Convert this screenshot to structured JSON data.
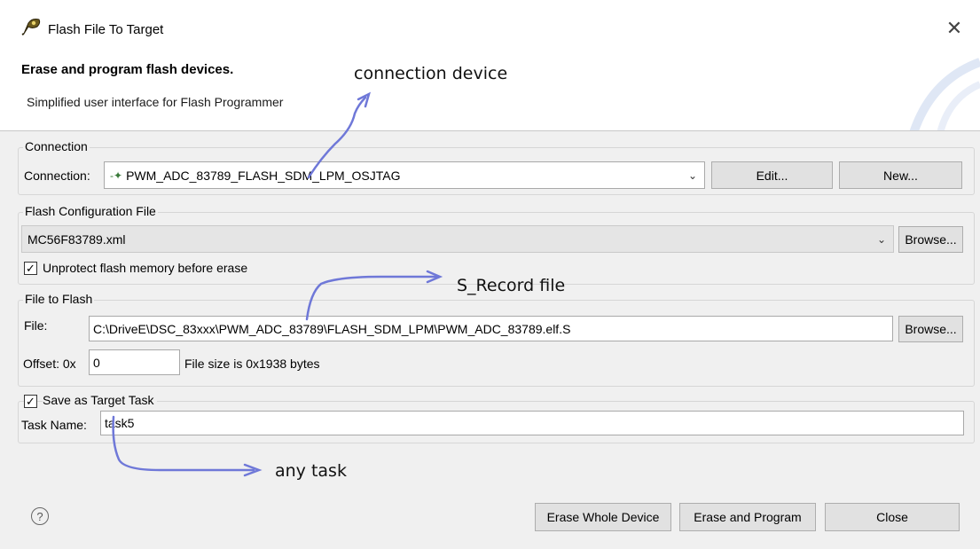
{
  "window": {
    "title": "Flash File To Target",
    "close_glyph": "✕"
  },
  "banner": {
    "title": "Erase and program flash devices.",
    "subtitle": "Simplified user interface for Flash Programmer"
  },
  "connection": {
    "group_label": "Connection",
    "label": "Connection:",
    "value": "PWM_ADC_83789_FLASH_SDM_LPM_OSJTAG",
    "edit_button": "Edit...",
    "new_button": "New..."
  },
  "flash_config": {
    "group_label": "Flash Configuration File",
    "value": "MC56F83789.xml",
    "browse_button": "Browse...",
    "unprotect_label": "Unprotect flash memory before erase",
    "unprotect_checked": true
  },
  "file_to_flash": {
    "group_label": "File to Flash",
    "file_label": "File:",
    "file_value": "C:\\DriveE\\DSC_83xxx\\PWM_ADC_83789\\FLASH_SDM_LPM\\PWM_ADC_83789.elf.S",
    "browse_button": "Browse...",
    "offset_label": "Offset: 0x",
    "offset_value": "0",
    "file_size_text": "File size is 0x1938 bytes"
  },
  "target_task": {
    "save_label": "Save as Target Task",
    "save_checked": true,
    "task_name_label": "Task Name:",
    "task_name_value": "task5"
  },
  "annotations": {
    "connection_device": "connection device",
    "s_record": "S_Record file",
    "any_task": "any task"
  },
  "footer": {
    "help_glyph": "?",
    "erase_whole_button": "Erase Whole Device",
    "erase_program_button": "Erase and Program",
    "close_button": "Close"
  },
  "colors": {
    "annotation_arrow": "#6f78d8"
  }
}
